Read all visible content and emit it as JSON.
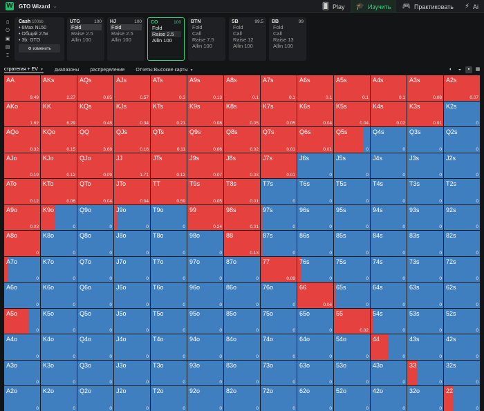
{
  "topbar": {
    "logo": "W",
    "brand": "GTO Wizard",
    "brand_chevron": "⌄",
    "nav": [
      {
        "label": "Play",
        "icon": "🂠",
        "icon_name": "cards-icon",
        "active": false
      },
      {
        "label": "Изучить",
        "icon": "🎓",
        "icon_name": "graduation-cap-icon",
        "active": true
      },
      {
        "label": "Практиковать",
        "icon": "🎮",
        "icon_name": "gamepad-icon",
        "active": false
      },
      {
        "label": "Ai",
        "icon": "⚡",
        "icon_name": "ai-icon",
        "active": false
      }
    ]
  },
  "rail_icons": [
    {
      "glyph": "▯",
      "name": "card-icon"
    },
    {
      "glyph": "⏻",
      "name": "power-icon"
    },
    {
      "glyph": "▣",
      "name": "save-icon"
    },
    {
      "glyph": "▤",
      "name": "layers-icon"
    },
    {
      "glyph": "⌶",
      "name": "cursor-icon"
    }
  ],
  "info": {
    "title": "Cash",
    "stack": "100bb",
    "lines": [
      "• 6Max NL50",
      "• Общий 2.5x",
      "• 3b: GTO"
    ],
    "button": "⚙ изменить"
  },
  "positions": [
    {
      "name": "UTG",
      "stack": "100",
      "selected": false,
      "actions": [
        {
          "label": "Fold",
          "hl": true
        },
        {
          "label": "Raise 2.5",
          "hl": false
        },
        {
          "label": "Allin 100",
          "hl": false
        }
      ]
    },
    {
      "name": "HJ",
      "stack": "100",
      "selected": false,
      "actions": [
        {
          "label": "Fold",
          "hl": true
        },
        {
          "label": "Raise 2.5",
          "hl": false
        },
        {
          "label": "Allin 100",
          "hl": false
        }
      ]
    },
    {
      "name": "CO",
      "stack": "100",
      "selected": true,
      "actions": [
        {
          "label": "Fold",
          "hl": false
        },
        {
          "label": "Raise 2.5",
          "hl": true
        },
        {
          "label": "Allin 100",
          "hl": false
        }
      ]
    },
    {
      "name": "BTN",
      "stack": "",
      "selected": false,
      "actions": [
        {
          "label": "Fold",
          "hl": false
        },
        {
          "label": "Call",
          "hl": false
        },
        {
          "label": "Raise 7.5",
          "hl": false
        },
        {
          "label": "Allin 100",
          "hl": false
        }
      ]
    },
    {
      "name": "SB",
      "stack": "99.5",
      "selected": false,
      "actions": [
        {
          "label": "Fold",
          "hl": false
        },
        {
          "label": "Call",
          "hl": false
        },
        {
          "label": "Raise 12",
          "hl": false
        },
        {
          "label": "Allin 100",
          "hl": false
        }
      ]
    },
    {
      "name": "BB",
      "stack": "99",
      "selected": false,
      "actions": [
        {
          "label": "Fold",
          "hl": false
        },
        {
          "label": "Call",
          "hl": false
        },
        {
          "label": "Raise 13",
          "hl": false
        },
        {
          "label": "Allin 100",
          "hl": false
        }
      ]
    }
  ],
  "tabs": [
    {
      "label": "стратегия + EV",
      "active": true,
      "dropdown": true
    },
    {
      "label": "диапазоны",
      "active": false,
      "dropdown": false
    },
    {
      "label": "распределение",
      "active": false,
      "dropdown": false
    },
    {
      "label": "Отчеты:Высокие карты",
      "active": false,
      "dropdown": true
    }
  ],
  "view_icons": [
    {
      "glyph": "◐",
      "name": "contrast-icon",
      "on": false
    },
    {
      "glyph": "◒",
      "name": "half-view-icon",
      "on": false
    },
    {
      "glyph": "▪",
      "name": "compact-view-icon",
      "on": true
    },
    {
      "glyph": "▦",
      "name": "grid-view-icon",
      "on": false
    }
  ],
  "colors": {
    "raise": "#e5423f",
    "fold": "#3f7fc0",
    "accent": "#2fd47f"
  },
  "grid": [
    [
      [
        "AA",
        1,
        "9.49"
      ],
      [
        "AKs",
        1,
        "2.27"
      ],
      [
        "AQs",
        1,
        "0.85"
      ],
      [
        "AJs",
        1,
        "0.57"
      ],
      [
        "ATs",
        1,
        "0.3"
      ],
      [
        "A9s",
        1,
        "0.13"
      ],
      [
        "A8s",
        1,
        "0.1"
      ],
      [
        "A7s",
        1,
        "0.1"
      ],
      [
        "A6s",
        1,
        "0.1"
      ],
      [
        "A5s",
        1,
        "0.1"
      ],
      [
        "A4s",
        1,
        "0.1"
      ],
      [
        "A3s",
        1,
        "0.08"
      ],
      [
        "A2s",
        1,
        "0.07"
      ]
    ],
    [
      [
        "AKo",
        1,
        "1.62"
      ],
      [
        "KK",
        1,
        "6.29"
      ],
      [
        "KQs",
        1,
        "0.48"
      ],
      [
        "KJs",
        1,
        "0.34"
      ],
      [
        "KTs",
        1,
        "0.21"
      ],
      [
        "K9s",
        1,
        "0.08"
      ],
      [
        "K8s",
        1,
        "0.05"
      ],
      [
        "K7s",
        1,
        "0.05"
      ],
      [
        "K6s",
        1,
        "0.04"
      ],
      [
        "K5s",
        1,
        "0.04"
      ],
      [
        "K4s",
        1,
        "0.02"
      ],
      [
        "K3s",
        1,
        "0.01"
      ],
      [
        "K2s",
        0,
        "0"
      ]
    ],
    [
      [
        "AQo",
        1,
        "0.32"
      ],
      [
        "KQo",
        1,
        "0.15"
      ],
      [
        "QQ",
        1,
        "3.68"
      ],
      [
        "QJs",
        1,
        "0.16"
      ],
      [
        "QTs",
        1,
        "0.11"
      ],
      [
        "Q9s",
        1,
        "0.06"
      ],
      [
        "Q8s",
        1,
        "0.02"
      ],
      [
        "Q7s",
        1,
        "0.01"
      ],
      [
        "Q6s",
        1,
        "0.01"
      ],
      [
        "Q5s",
        0.8,
        "0"
      ],
      [
        "Q4s",
        0,
        "0"
      ],
      [
        "Q3s",
        0,
        "0"
      ],
      [
        "Q2s",
        0,
        "0"
      ]
    ],
    [
      [
        "AJo",
        1,
        "0.19"
      ],
      [
        "KJo",
        1,
        "0.12"
      ],
      [
        "QJo",
        1,
        "0.09"
      ],
      [
        "JJ",
        1,
        "1.71"
      ],
      [
        "JTs",
        1,
        "0.12"
      ],
      [
        "J9s",
        1,
        "0.07"
      ],
      [
        "J8s",
        1,
        "0.03"
      ],
      [
        "J7s",
        1,
        "0.01"
      ],
      [
        "J6s",
        0,
        "0"
      ],
      [
        "J5s",
        0,
        "0"
      ],
      [
        "J4s",
        0,
        "0"
      ],
      [
        "J3s",
        0,
        "0"
      ],
      [
        "J2s",
        0,
        "0"
      ]
    ],
    [
      [
        "ATo",
        1,
        "0.12"
      ],
      [
        "KTo",
        1,
        "0.06"
      ],
      [
        "QTo",
        1,
        "0.04"
      ],
      [
        "JTo",
        1,
        "0.04"
      ],
      [
        "TT",
        1,
        "0.59"
      ],
      [
        "T9s",
        1,
        "0.05"
      ],
      [
        "T8s",
        1,
        "0.01"
      ],
      [
        "T7s",
        0,
        "0"
      ],
      [
        "T6s",
        0,
        "0"
      ],
      [
        "T5s",
        0,
        "0"
      ],
      [
        "T4s",
        0,
        "0"
      ],
      [
        "T3s",
        0,
        "0"
      ],
      [
        "T2s",
        0,
        "0"
      ]
    ],
    [
      [
        "A9o",
        1,
        "0.03"
      ],
      [
        "K9o",
        0.4,
        "0"
      ],
      [
        "Q9o",
        0,
        "0"
      ],
      [
        "J9o",
        0.1,
        "0"
      ],
      [
        "T9o",
        0,
        "0"
      ],
      [
        "99",
        1,
        "0.24"
      ],
      [
        "98s",
        1,
        "0.01"
      ],
      [
        "97s",
        0.05,
        "0"
      ],
      [
        "96s",
        0,
        "0"
      ],
      [
        "95s",
        0,
        "0"
      ],
      [
        "94s",
        0,
        "0"
      ],
      [
        "93s",
        0,
        "0"
      ],
      [
        "92s",
        0,
        "0"
      ]
    ],
    [
      [
        "A8o",
        1,
        "0"
      ],
      [
        "K8o",
        0,
        "0"
      ],
      [
        "Q8o",
        0,
        "0"
      ],
      [
        "J8o",
        0,
        "0"
      ],
      [
        "T8o",
        0,
        "0"
      ],
      [
        "98o",
        0,
        "0"
      ],
      [
        "88",
        1,
        "0.13"
      ],
      [
        "87s",
        0.05,
        "0"
      ],
      [
        "86s",
        0,
        "0"
      ],
      [
        "85s",
        0,
        "0"
      ],
      [
        "84s",
        0,
        "0"
      ],
      [
        "83s",
        0,
        "0"
      ],
      [
        "82s",
        0,
        "0"
      ]
    ],
    [
      [
        "A7o",
        0.1,
        "0"
      ],
      [
        "K7o",
        0,
        "0"
      ],
      [
        "Q7o",
        0,
        "0"
      ],
      [
        "J7o",
        0,
        "0"
      ],
      [
        "T7o",
        0,
        "0"
      ],
      [
        "97o",
        0,
        "0"
      ],
      [
        "87o",
        0,
        "0"
      ],
      [
        "77",
        1,
        "0.09"
      ],
      [
        "76s",
        0.1,
        "0"
      ],
      [
        "75s",
        0,
        "0"
      ],
      [
        "74s",
        0,
        "0"
      ],
      [
        "73s",
        0,
        "0"
      ],
      [
        "72s",
        0,
        "0"
      ]
    ],
    [
      [
        "A6o",
        0,
        "0"
      ],
      [
        "K6o",
        0,
        "0"
      ],
      [
        "Q6o",
        0,
        "0"
      ],
      [
        "J6o",
        0,
        "0"
      ],
      [
        "T6o",
        0,
        "0"
      ],
      [
        "96o",
        0,
        "0"
      ],
      [
        "86o",
        0,
        "0"
      ],
      [
        "76o",
        0,
        "0"
      ],
      [
        "66",
        1,
        "0.06"
      ],
      [
        "65s",
        0.05,
        "0"
      ],
      [
        "64s",
        0,
        "0"
      ],
      [
        "63s",
        0,
        "0"
      ],
      [
        "62s",
        0,
        "0"
      ]
    ],
    [
      [
        "A5o",
        0.7,
        "0"
      ],
      [
        "K5o",
        0,
        "0"
      ],
      [
        "Q5o",
        0,
        "0"
      ],
      [
        "J5o",
        0,
        "0"
      ],
      [
        "T5o",
        0,
        "0"
      ],
      [
        "95o",
        0,
        "0"
      ],
      [
        "85o",
        0,
        "0"
      ],
      [
        "75o",
        0,
        "0"
      ],
      [
        "65o",
        0,
        "0"
      ],
      [
        "55",
        1,
        "0.02"
      ],
      [
        "54s",
        0.05,
        "0"
      ],
      [
        "53s",
        0,
        "0"
      ],
      [
        "52s",
        0,
        "0"
      ]
    ],
    [
      [
        "A4o",
        0,
        "0"
      ],
      [
        "K4o",
        0,
        "0"
      ],
      [
        "Q4o",
        0,
        "0"
      ],
      [
        "J4o",
        0,
        "0"
      ],
      [
        "T4o",
        0,
        "0"
      ],
      [
        "94o",
        0,
        "0"
      ],
      [
        "84o",
        0,
        "0"
      ],
      [
        "74o",
        0,
        "0"
      ],
      [
        "64o",
        0,
        "0"
      ],
      [
        "54o",
        0,
        "0"
      ],
      [
        "44",
        0.5,
        "0"
      ],
      [
        "43s",
        0,
        "0"
      ],
      [
        "42s",
        0,
        "0"
      ]
    ],
    [
      [
        "A3o",
        0,
        "0"
      ],
      [
        "K3o",
        0,
        "0"
      ],
      [
        "Q3o",
        0,
        "0"
      ],
      [
        "J3o",
        0,
        "0"
      ],
      [
        "T3o",
        0,
        "0"
      ],
      [
        "93o",
        0,
        "0"
      ],
      [
        "83o",
        0,
        "0"
      ],
      [
        "73o",
        0,
        "0"
      ],
      [
        "63o",
        0,
        "0"
      ],
      [
        "53o",
        0,
        "0"
      ],
      [
        "43o",
        0,
        "0"
      ],
      [
        "33",
        0.28,
        "0"
      ],
      [
        "32s",
        0,
        "0"
      ]
    ],
    [
      [
        "A2o",
        0,
        "0"
      ],
      [
        "K2o",
        0,
        "0"
      ],
      [
        "Q2o",
        0,
        "0"
      ],
      [
        "J2o",
        0,
        "0"
      ],
      [
        "T2o",
        0,
        "0"
      ],
      [
        "92o",
        0,
        "0"
      ],
      [
        "82o",
        0,
        "0"
      ],
      [
        "72o",
        0,
        "0"
      ],
      [
        "62o",
        0,
        "0"
      ],
      [
        "52o",
        0,
        "0"
      ],
      [
        "42o",
        0,
        "0"
      ],
      [
        "32o",
        0,
        "0"
      ],
      [
        "22",
        0.25,
        "0"
      ]
    ]
  ]
}
